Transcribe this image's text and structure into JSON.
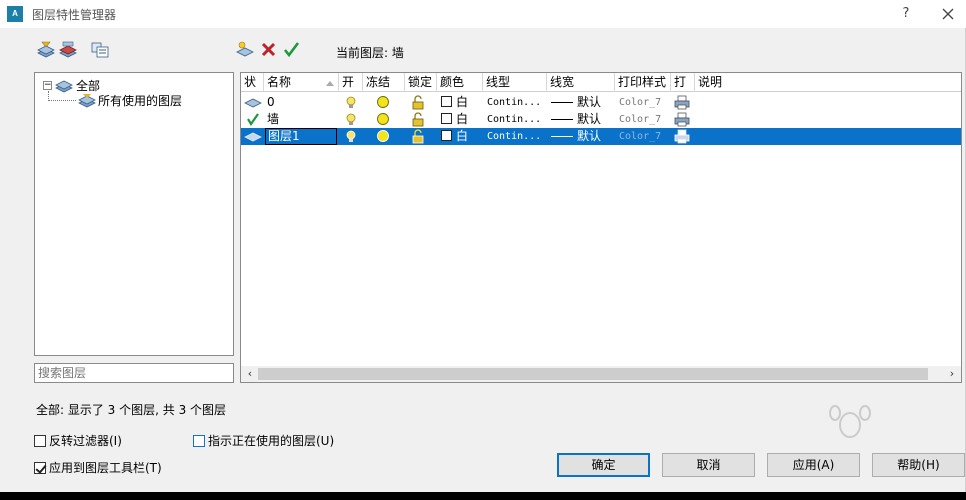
{
  "window": {
    "title": "图层特性管理器",
    "app_icon_text": "A",
    "help_label": "?"
  },
  "toolbar": {
    "current_layer_label": "当前图层: 墙"
  },
  "tree": {
    "root_label": "全部",
    "root_expander": "⊟",
    "child_label": "所有使用的图层"
  },
  "search": {
    "placeholder": "搜索图层"
  },
  "grid": {
    "columns": [
      "状",
      "名称",
      "开",
      "冻结",
      "锁定",
      "颜色",
      "线型",
      "线宽",
      "打印样式",
      "打",
      "说明"
    ],
    "rows": [
      {
        "name": "0",
        "color": "白",
        "linetype": "Contin...",
        "lineweight": "默认",
        "plotstyle": "Color_7"
      },
      {
        "name": "墙",
        "color": "白",
        "linetype": "Contin...",
        "lineweight": "默认",
        "plotstyle": "Color_7"
      },
      {
        "name": "图层1",
        "color": "白",
        "linetype": "Contin...",
        "lineweight": "默认",
        "plotstyle": "Color_7"
      }
    ]
  },
  "status": "全部: 显示了 3 个图层, 共 3 个图层",
  "options": {
    "invert_filter": "反转过滤器(I)",
    "indicate_in_use": "指示正在使用的图层(U)",
    "apply_to_toolbar": "应用到图层工具栏(T)"
  },
  "buttons": {
    "ok": "确定",
    "cancel": "取消",
    "apply": "应用(A)",
    "help": "帮助(H)"
  },
  "colors": {
    "selection": "#0a72c8",
    "ok_border": "#0a72c8"
  }
}
